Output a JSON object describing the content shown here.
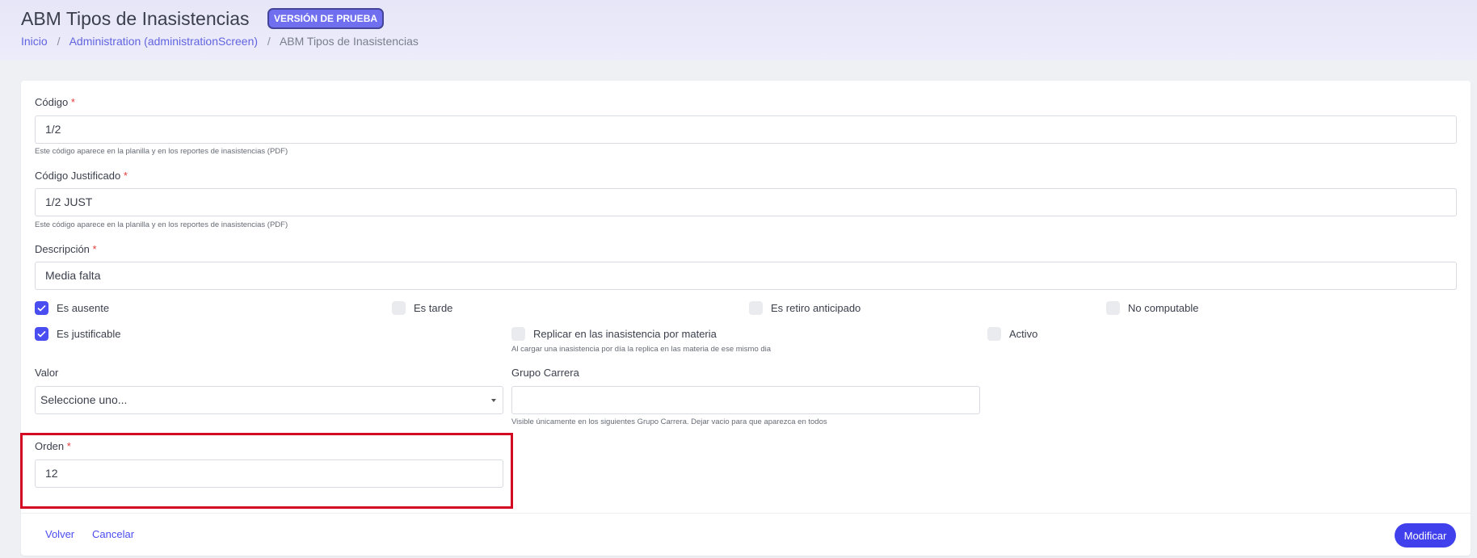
{
  "header": {
    "title": "ABM Tipos de Inasistencias",
    "badge": "VERSIÓN DE PRUEBA",
    "breadcrumb": {
      "home": "Inicio",
      "admin": "Administration (administrationScreen)",
      "current": "ABM Tipos de Inasistencias",
      "separator": "/"
    }
  },
  "form": {
    "codigo": {
      "label": "Código",
      "required_mark": "*",
      "value": "1/2",
      "hint": "Este código aparece en la planilla y en los reportes de inasistencias (PDF)"
    },
    "codigo_justificado": {
      "label": "Código Justificado",
      "required_mark": "*",
      "value": "1/2 JUST",
      "hint": "Este código aparece en la planilla y en los reportes de inasistencias (PDF)"
    },
    "descripcion": {
      "label": "Descripción",
      "required_mark": "*",
      "value": "Media falta"
    },
    "checks": {
      "es_ausente": {
        "label": "Es ausente",
        "checked": true
      },
      "es_tarde": {
        "label": "Es tarde",
        "checked": false
      },
      "es_retiro_anticipado": {
        "label": "Es retiro anticipado",
        "checked": false
      },
      "no_computable": {
        "label": "No computable",
        "checked": false
      },
      "es_justificable": {
        "label": "Es justificable",
        "checked": true
      },
      "replicar": {
        "label": "Replicar en las inasistencia por materia",
        "checked": false,
        "hint": "Al cargar una inasistencia por día la replica en las materia de ese mismo dia"
      },
      "activo": {
        "label": "Activo",
        "checked": false
      }
    },
    "valor": {
      "label": "Valor",
      "selected": "Seleccione uno..."
    },
    "grupo_carrera": {
      "label": "Grupo Carrera",
      "value": "",
      "hint": "Visible únicamente en los siguientes Grupo Carrera. Dejar vacio para que aparezca en todos"
    },
    "orden": {
      "label": "Orden",
      "required_mark": "*",
      "value": "12"
    }
  },
  "footer": {
    "volver": "Volver",
    "cancelar": "Cancelar",
    "modificar": "Modificar"
  },
  "colors": {
    "accent": "#4a4df0",
    "badge": "#6f6ff0",
    "required": "#e23c3c",
    "highlight": "#d40a22"
  }
}
